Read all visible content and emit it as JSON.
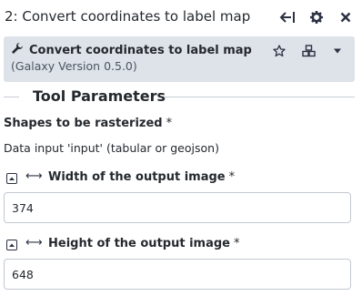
{
  "panel": {
    "title": "2: Convert coordinates to label map",
    "icons": [
      "collapse-left-icon",
      "gear-icon",
      "close-icon"
    ]
  },
  "tool": {
    "name": "Convert coordinates to label map",
    "version": "(Galaxy Version 0.5.0)",
    "icon": "wrench-icon",
    "actions": [
      "star-icon",
      "cubes-icon",
      "caret-down-icon"
    ]
  },
  "section": {
    "title": "Tool Parameters"
  },
  "params": {
    "shapes": {
      "label": "Shapes to be rasterized",
      "required": "*",
      "value": "Data input 'input' (tabular or geojson)"
    },
    "width": {
      "label": "Width of the output image",
      "required": "*",
      "value": "374"
    },
    "height": {
      "label": "Height of the output image",
      "required": "*",
      "value": "648"
    }
  }
}
